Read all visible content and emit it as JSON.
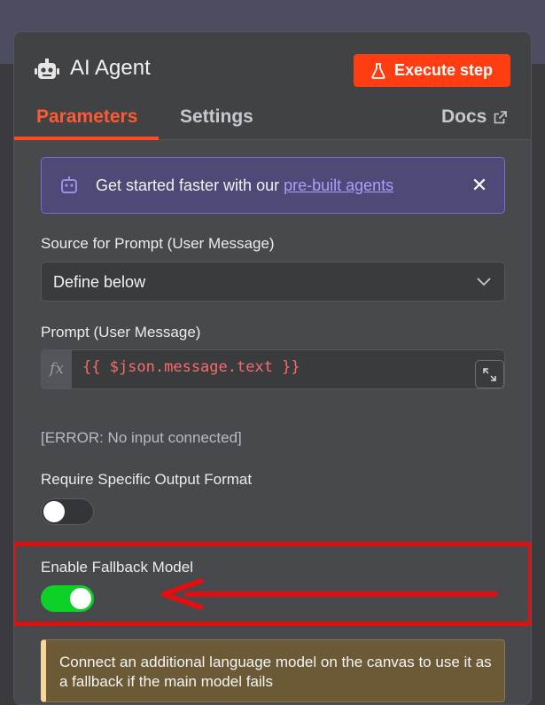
{
  "header": {
    "title": "AI Agent",
    "execute_label": "Execute step"
  },
  "tabs": [
    {
      "label": "Parameters",
      "active": true
    },
    {
      "label": "Settings",
      "active": false
    },
    {
      "label": "Docs",
      "active": false
    }
  ],
  "banner": {
    "text": "Get started faster with our ",
    "link": "pre-built agents"
  },
  "fields": {
    "source_label": "Source for Prompt (User Message)",
    "source_value": "Define below",
    "prompt_label": "Prompt (User Message)",
    "prompt_value": "{{ $json.message.text }}",
    "prompt_error": "[ERROR: No input connected]",
    "output_format_label": "Require Specific Output Format",
    "output_format_enabled": false,
    "fallback_label": "Enable Fallback Model",
    "fallback_enabled": true
  },
  "notice": {
    "text": "Connect an additional language model on the canvas to use it as a fallback if the main model fails"
  },
  "icons": {
    "header": "robot-icon",
    "execute": "flask-icon",
    "docs": "external-link-icon",
    "banner": "robot-icon",
    "close": "close-icon",
    "select": "chevron-down-icon",
    "expand": "expand-icon"
  },
  "colors": {
    "accent": "#ff3d10",
    "toggle_on": "#0ed128",
    "annotation": "#e20f11",
    "banner_border": "#7a6bd8",
    "notice_bar": "#f6d69a"
  }
}
